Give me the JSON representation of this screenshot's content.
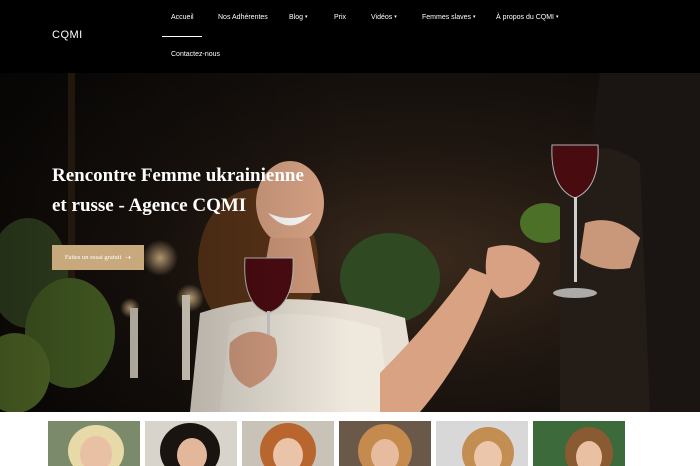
{
  "header": {
    "logo": "CQMI",
    "nav": [
      {
        "label": "Accueil",
        "dropdown": false
      },
      {
        "label": "Nos Adhérentes",
        "dropdown": false
      },
      {
        "label": "Blog",
        "dropdown": true
      },
      {
        "label": "Prix",
        "dropdown": false
      },
      {
        "label": "Vidéos",
        "dropdown": true
      },
      {
        "label": "Femmes slaves",
        "dropdown": true
      },
      {
        "label": "À propos du CQMI",
        "dropdown": true
      },
      {
        "label": "Contactez-nous",
        "dropdown": false
      }
    ]
  },
  "hero": {
    "title": "Rencontre Femme ukrainienne et russe - Agence CQMI",
    "cta_label": "Faites un essai gratuit",
    "cta_icon": "arrow-right-icon"
  },
  "colors": {
    "header_bg": "#000000",
    "accent": "#c8a97e"
  },
  "profiles": [
    {
      "hair": "#e8d9a8",
      "bg": "#7a8a6a"
    },
    {
      "hair": "#1a1410",
      "bg": "#d8d4cc"
    },
    {
      "hair": "#b8652e",
      "bg": "#c9c2b6"
    },
    {
      "hair": "#c48a4e",
      "bg": "#6a5848"
    },
    {
      "hair": "#c28e52",
      "bg": "#d8d8d8"
    },
    {
      "hair": "#8a5a32",
      "bg": "#3c6a3a"
    }
  ]
}
